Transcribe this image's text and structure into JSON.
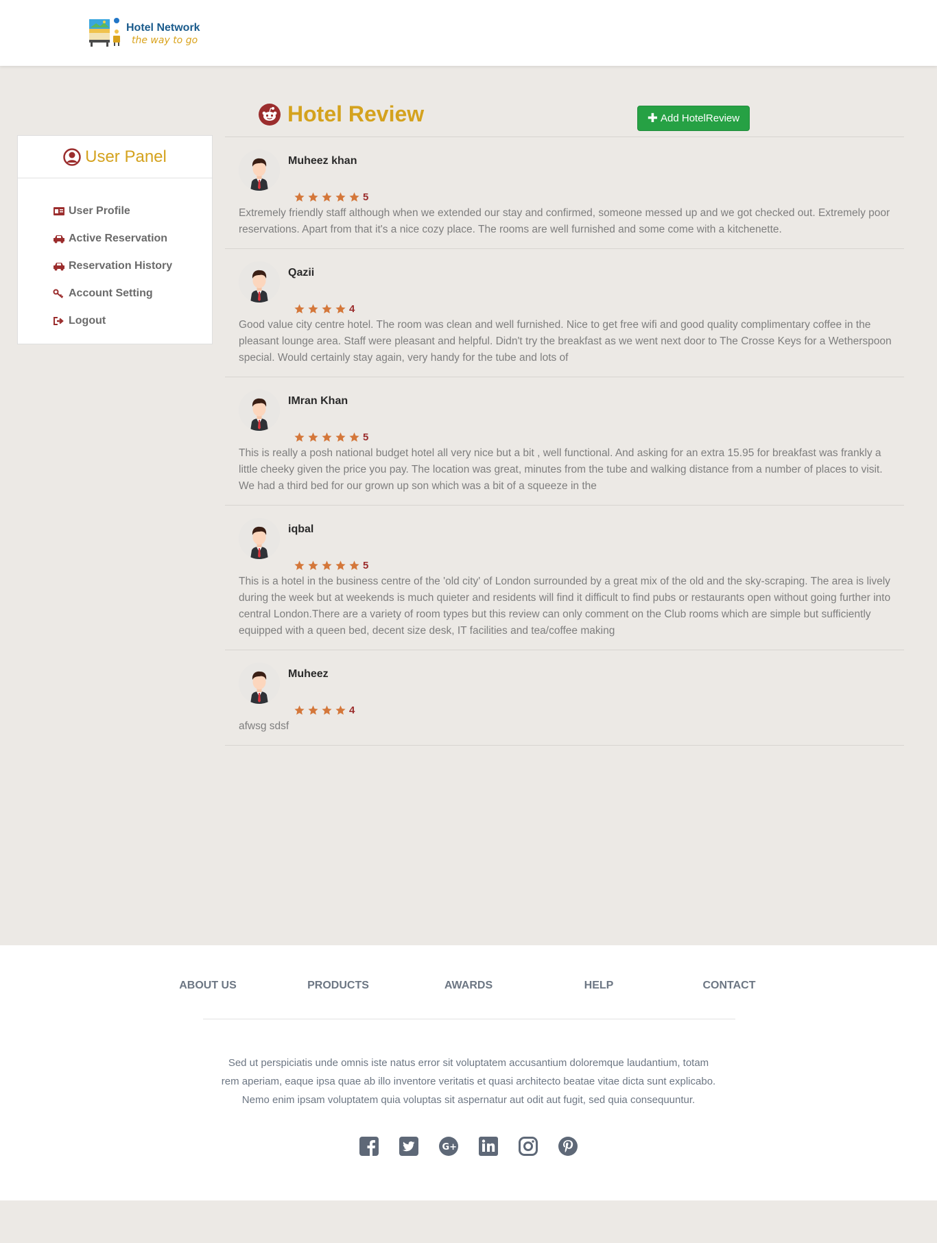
{
  "header": {
    "brand_name": "Hotel Network",
    "brand_tagline": "the way to go"
  },
  "sidebar": {
    "title": "User Panel",
    "items": [
      {
        "label": "User Profile",
        "icon": "id-card-icon"
      },
      {
        "label": "Active Reservation",
        "icon": "car-icon"
      },
      {
        "label": "Reservation History",
        "icon": "car-icon"
      },
      {
        "label": "Account Setting",
        "icon": "key-icon"
      },
      {
        "label": "Logout",
        "icon": "sign-out-icon"
      }
    ]
  },
  "main": {
    "title": "Hotel Review",
    "title_icon": "reddit-icon",
    "add_button_label": "Add HotelReview"
  },
  "reviews": [
    {
      "name": "Muheez khan",
      "rating": 5,
      "text": "Extremely friendly staff although when we extended our stay and confirmed, someone messed up and we got checked out. Extremely poor reservations. Apart from that it's a nice cozy place. The rooms are well furnished and some come with a kitchenette."
    },
    {
      "name": "Qazii",
      "rating": 4,
      "text": "Good value city centre hotel. The room was clean and well furnished. Nice to get free wifi and good quality complimentary coffee in the pleasant lounge area. Staff were pleasant and helpful. Didn't try the breakfast as we went next door to The Crosse Keys for a Wetherspoon special. Would certainly stay again, very handy for the tube and lots of"
    },
    {
      "name": "IMran Khan",
      "rating": 5,
      "text": "This is really a posh national budget hotel all very nice but a bit , well functional. And asking for an extra 15.95 for breakfast was frankly a little cheeky given the price you pay. The location was great, minutes from the tube and walking distance from a number of places to visit. We had a third bed for our grown up son which was a bit of a squeeze in the"
    },
    {
      "name": "iqbal",
      "rating": 5,
      "text": "This is a hotel in the business centre of the 'old city' of London surrounded by a great mix of the old and the sky-scraping. The area is lively during the week but at weekends is much quieter and residents will find it difficult to find pubs or restaurants open without going further into central London.There are a variety of room types but this review can only comment on the Club rooms which are simple but sufficiently equipped with a queen bed, decent size desk, IT facilities and tea/coffee making"
    },
    {
      "name": "Muheez",
      "rating": 4,
      "text": "afwsg sdsf"
    }
  ],
  "footer": {
    "links": [
      "ABOUT US",
      "PRODUCTS",
      "AWARDS",
      "HELP",
      "CONTACT"
    ],
    "text": "Sed ut perspiciatis unde omnis iste natus error sit voluptatem accusantium doloremque laudantium, totam rem aperiam, eaque ipsa quae ab illo inventore veritatis et quasi architecto beatae vitae dicta sunt explicabo. Nemo enim ipsam voluptatem quia voluptas sit aspernatur aut odit aut fugit, sed quia consequuntur.",
    "socials": [
      "facebook-icon",
      "twitter-icon",
      "google-plus-icon",
      "linkedin-icon",
      "instagram-icon",
      "pinterest-icon"
    ]
  },
  "colors": {
    "accent": "#d4a21e",
    "brand": "#1a5b8c",
    "button": "#26a144",
    "star": "#d4773a",
    "rating_number": "#9b2d2d",
    "page_bg": "#ece9e5"
  }
}
